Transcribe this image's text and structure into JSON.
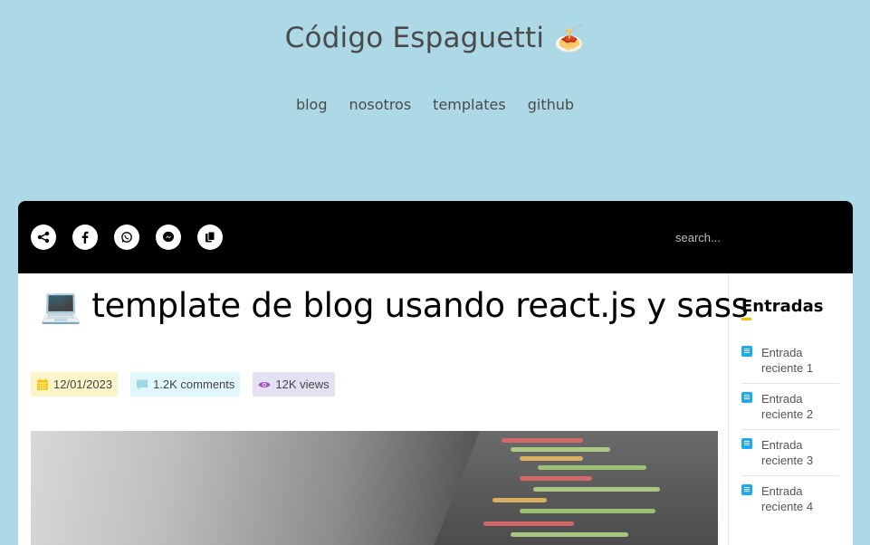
{
  "header": {
    "title": "Código Espaguetti",
    "title_emoji": "🍝",
    "nav": [
      "blog",
      "nosotros",
      "templates",
      "github"
    ]
  },
  "toolbar": {
    "share_buttons": [
      {
        "name": "share-icon"
      },
      {
        "name": "facebook-icon"
      },
      {
        "name": "whatsapp-icon"
      },
      {
        "name": "messenger-icon"
      },
      {
        "name": "copy-icon"
      }
    ],
    "search_placeholder": "search..."
  },
  "post": {
    "emoji": "💻",
    "title": "template de blog usando react.js y sass",
    "date": "12/01/2023",
    "comments": "1.2K comments",
    "views": "12K views"
  },
  "sidebar": {
    "heading": "Entradas",
    "entries": [
      "Entrada reciente 1",
      "Entrada reciente 2",
      "Entrada reciente 3",
      "Entrada reciente 4"
    ]
  },
  "colors": {
    "background": "#add8e6",
    "toolbar": "#000000",
    "accent": "#f5c400",
    "entry_icon": "#1eaaf1"
  }
}
